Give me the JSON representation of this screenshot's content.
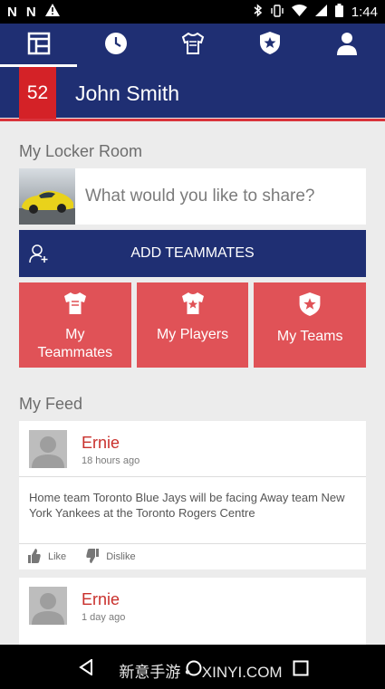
{
  "status": {
    "left_icons": [
      "N",
      "N"
    ],
    "time": "1:44"
  },
  "nav": {
    "tabs": [
      {
        "icon": "dashboard-icon"
      },
      {
        "icon": "clock-icon"
      },
      {
        "icon": "jersey-icon"
      },
      {
        "icon": "shield-star-icon"
      },
      {
        "icon": "person-icon"
      }
    ],
    "active_index": 0
  },
  "profile": {
    "number": "52",
    "name": "John Smith"
  },
  "locker": {
    "title": "My Locker Room",
    "share_placeholder": "What would you like to share?",
    "add_label": "ADD TEAMMATES",
    "tiles": [
      {
        "label": "My\nTeammates",
        "icon": "jersey-icon"
      },
      {
        "label": "My Players",
        "icon": "jersey-star-icon"
      },
      {
        "label": "My Teams",
        "icon": "shield-star-icon"
      }
    ]
  },
  "feed": {
    "title": "My Feed",
    "posts": [
      {
        "author": "Ernie",
        "time": "18 hours ago",
        "text": "Home team Toronto Blue Jays will be facing Away team New York Yankees at the Toronto Rogers Centre",
        "like": "Like",
        "dislike": "Dislike"
      },
      {
        "author": "Ernie",
        "time": "1 day ago"
      }
    ]
  },
  "watermark": "新意手游 • ",
  "watermark2": "XINYI.COM",
  "colors": {
    "navy": "#1f2f73",
    "red": "#d42227",
    "tile": "#e05257"
  }
}
